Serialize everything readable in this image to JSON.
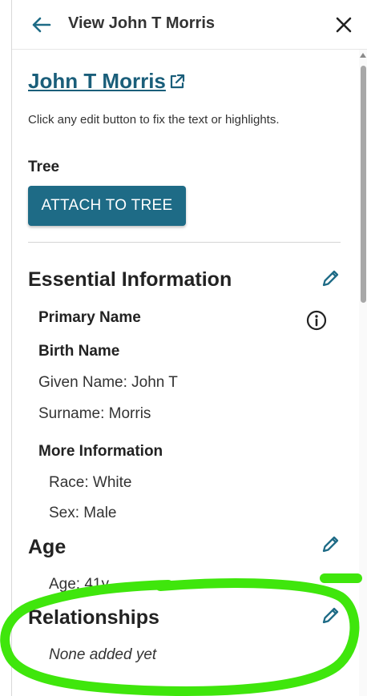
{
  "header": {
    "title": "View John T Morris"
  },
  "record": {
    "name": "John T Morris",
    "hint": "Click any edit button to fix the text or highlights."
  },
  "tree": {
    "label": "Tree",
    "attach_label": "ATTACH TO TREE"
  },
  "essential": {
    "title": "Essential Information",
    "primary_name": "Primary Name",
    "birth_name": "Birth Name",
    "given_name": "Given Name: John T",
    "surname": "Surname: Morris",
    "more_info": "More Information",
    "race": "Race: White",
    "sex": "Sex: Male"
  },
  "age": {
    "title": "Age",
    "value": "Age: 41y"
  },
  "relationships": {
    "title": "Relationships",
    "empty": "None added yet"
  },
  "colors": {
    "accent": "#1e6b86",
    "link": "#1a5e7a",
    "annotation": "#3fe60c"
  },
  "icons": {
    "back": "arrow-left-icon",
    "close": "close-icon",
    "external": "external-link-icon",
    "edit": "pencil-icon",
    "info": "info-circle-icon"
  }
}
